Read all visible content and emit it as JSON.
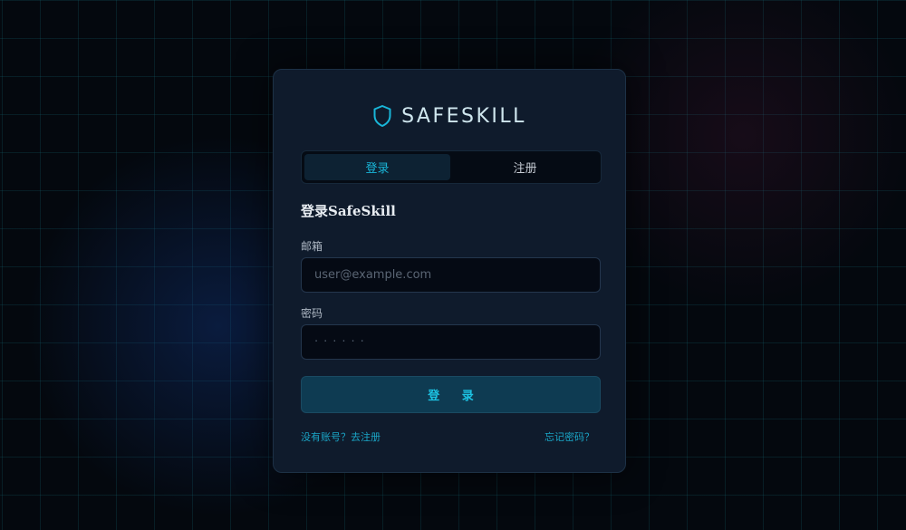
{
  "brand": {
    "name": "SAFESKILL",
    "icon": "shield-icon",
    "accent_color": "#19b6d8"
  },
  "tabs": [
    {
      "label": "登录",
      "active": true
    },
    {
      "label": "注册",
      "active": false
    }
  ],
  "form": {
    "title": "登录SafeSkill",
    "email": {
      "label": "邮箱",
      "placeholder": "user@example.com",
      "value": ""
    },
    "password": {
      "label": "密码",
      "placeholder": "······",
      "value": ""
    },
    "submit_label": "登 录"
  },
  "footer": {
    "register_link": "没有账号？去注册",
    "forgot_link": "忘记密码？"
  }
}
